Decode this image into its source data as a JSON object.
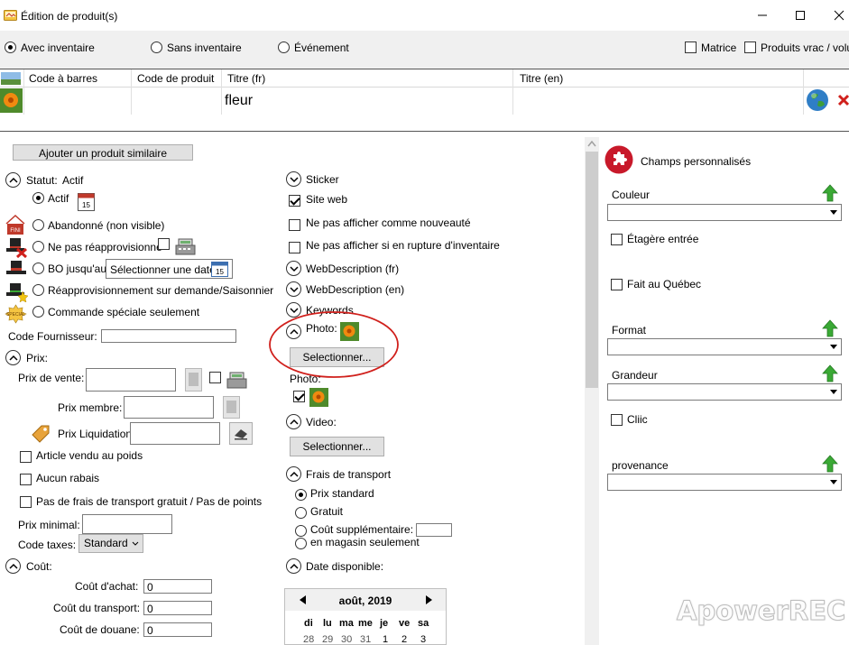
{
  "window": {
    "title": "Édition de produit(s)"
  },
  "modes": {
    "with_inventory": "Avec inventaire",
    "without_inventory": "Sans inventaire",
    "event": "Événement",
    "matrix": "Matrice",
    "bulk": "Produits vrac / volur"
  },
  "grid": {
    "headers": [
      "Code à barres",
      "Code de produit",
      "Titre (fr)",
      "Titre (en)"
    ],
    "row": {
      "barcode": "",
      "product_code": "",
      "title_fr": "fleur",
      "title_en": ""
    }
  },
  "left": {
    "add_similar": "Ajouter un produit similaire",
    "status_label": "Statut:",
    "status_value": "Actif",
    "status_options": [
      "Actif",
      "Abandonné (non visible)",
      "Ne pas réapprovisionné",
      "BO jusqu'au",
      "Réapprovisionnement sur demande/Saisonnier",
      "Commande spéciale seulement"
    ],
    "bo_date_placeholder": "Sélectionner une date",
    "calendar_day": "15",
    "supplier_code_label": "Code Fournisseur:",
    "price_section": "Prix:",
    "sale_price_label": "Prix de vente:",
    "member_price_label": "Prix membre:",
    "liquidation_price_label": "Prix Liquidation",
    "sold_by_weight": "Article vendu au poids",
    "no_discount": "Aucun rabais",
    "no_free_shipping": "Pas de frais de transport gratuit / Pas de points",
    "min_price_label": "Prix minimal:",
    "tax_code_label": "Code taxes:",
    "tax_code_value": "Standard",
    "cost_section": "Coût:",
    "purchase_cost_label": "Coût d'achat:",
    "purchase_cost_value": "0",
    "transport_cost_label": "Coût du transport:",
    "transport_cost_value": "0",
    "customs_cost_label": "Coût de douane:",
    "customs_cost_value": "0",
    "fini_badge": "FINI",
    "special_badge": "SPECIAL"
  },
  "middle": {
    "sticker": "Sticker",
    "website": "Site web",
    "not_new": "Ne pas afficher comme nouveauté",
    "not_out_of_stock": "Ne pas afficher si en rupture d'inventaire",
    "web_desc_fr": "WebDescription (fr)",
    "web_desc_en": "WebDescription (en)",
    "keywords": "Keywords",
    "photo_label": "Photo:",
    "select_button": "Selectionner...",
    "photo_label2": "Photo:",
    "video_label": "Video:",
    "select_button2": "Selectionner...",
    "shipping_section": "Frais de transport",
    "shipping_standard": "Prix standard",
    "shipping_free": "Gratuit",
    "shipping_extra": "Coût supplémentaire:",
    "shipping_store_only": "en magasin seulement",
    "available_date": "Date disponible:",
    "calendar": {
      "month": "août, 2019",
      "weekdays": [
        "di",
        "lu",
        "ma",
        "me",
        "je",
        "ve",
        "sa"
      ],
      "first_row": [
        "28",
        "29",
        "30",
        "31",
        "1",
        "2",
        "3"
      ]
    }
  },
  "right": {
    "custom_fields_title": "Champs personnalisés",
    "color_label": "Couleur",
    "shelf_entry": "Étagère entrée",
    "made_in_quebec": "Fait au Québec",
    "format_label": "Format",
    "size_label": "Grandeur",
    "cliic": "Cliic",
    "origin_label": "provenance"
  },
  "watermark": "ApowerREC",
  "colors": {
    "annotation_red": "#d0201c",
    "green_arrow": "#3aa935",
    "puzzle_red": "#c8192a"
  }
}
